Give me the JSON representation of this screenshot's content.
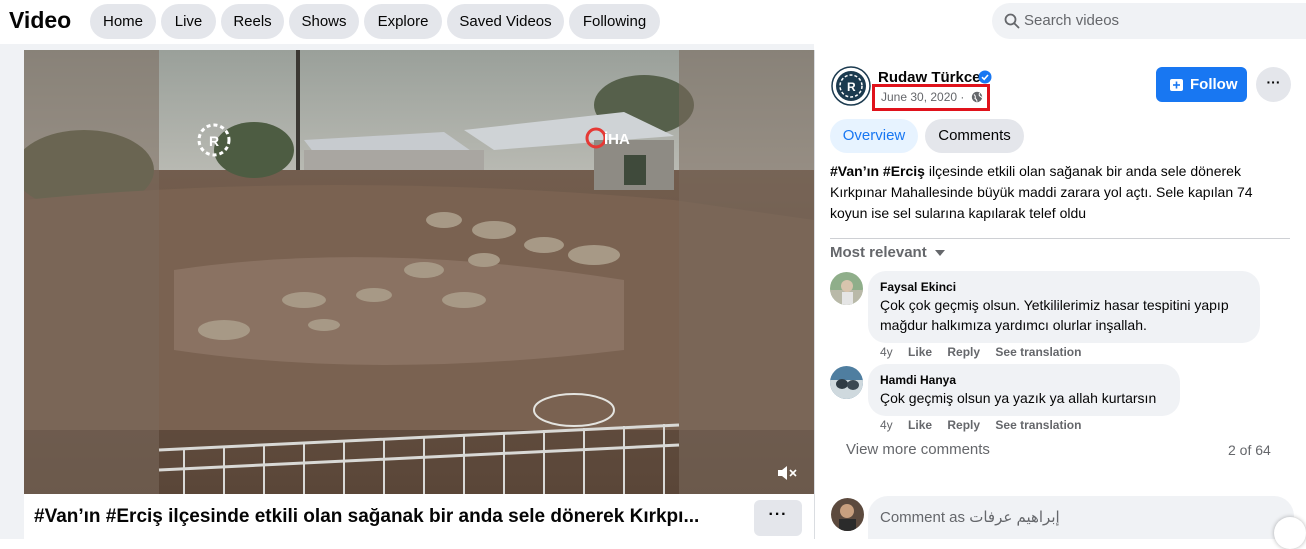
{
  "header": {
    "title": "Video",
    "nav": [
      "Home",
      "Live",
      "Reels",
      "Shows",
      "Explore",
      "Saved Videos",
      "Following"
    ],
    "search_placeholder": "Search videos"
  },
  "video": {
    "watermark_left": "R",
    "watermark_right": "İHA",
    "caption": "#Van’ın #Erciş ilçesinde etkili olan sağanak bir anda sele dönerek Kırkpı...",
    "more_label": "···",
    "mute_icon": "speaker-muted-icon"
  },
  "post": {
    "page_name": "Rudaw Türkce",
    "avatar_letter": "R",
    "date": "June 30, 2020 ·",
    "follow_label": "Follow",
    "more_label": "···",
    "tabs": [
      "Overview",
      "Comments"
    ],
    "description_hashtags": [
      "#Van’ın",
      "#Erciş"
    ],
    "description_rest": " ilçesinde etkili olan sağanak bir anda sele dönerek Kırkpınar Mahallesinde büyük maddi zarara yol açtı. Sele kapılan 74 koyun ise sel sularına kapılarak telef oldu",
    "sort_label": "Most relevant",
    "comments": [
      {
        "name": "Faysal Ekinci",
        "text": "Çok çok geçmiş olsun. Yetkililerimiz hasar tespitini yapıp mağdur halkımıza yardımcı olurlar inşallah.",
        "age": "4y",
        "like": "Like",
        "reply": "Reply",
        "translate": "See translation"
      },
      {
        "name": "Hamdi Hanya",
        "text": "Çok geçmiş olsun ya yazık ya allah kurtarsın",
        "age": "4y",
        "like": "Like",
        "reply": "Reply",
        "translate": "See translation"
      }
    ],
    "view_more": "View more comments",
    "count": "2 of 64",
    "comment_placeholder": "Comment as إبراهيم عرفات"
  },
  "colors": {
    "accent": "#1877f2",
    "highlight_box": "#e0121b",
    "pill_bg": "#e4e6eb"
  }
}
